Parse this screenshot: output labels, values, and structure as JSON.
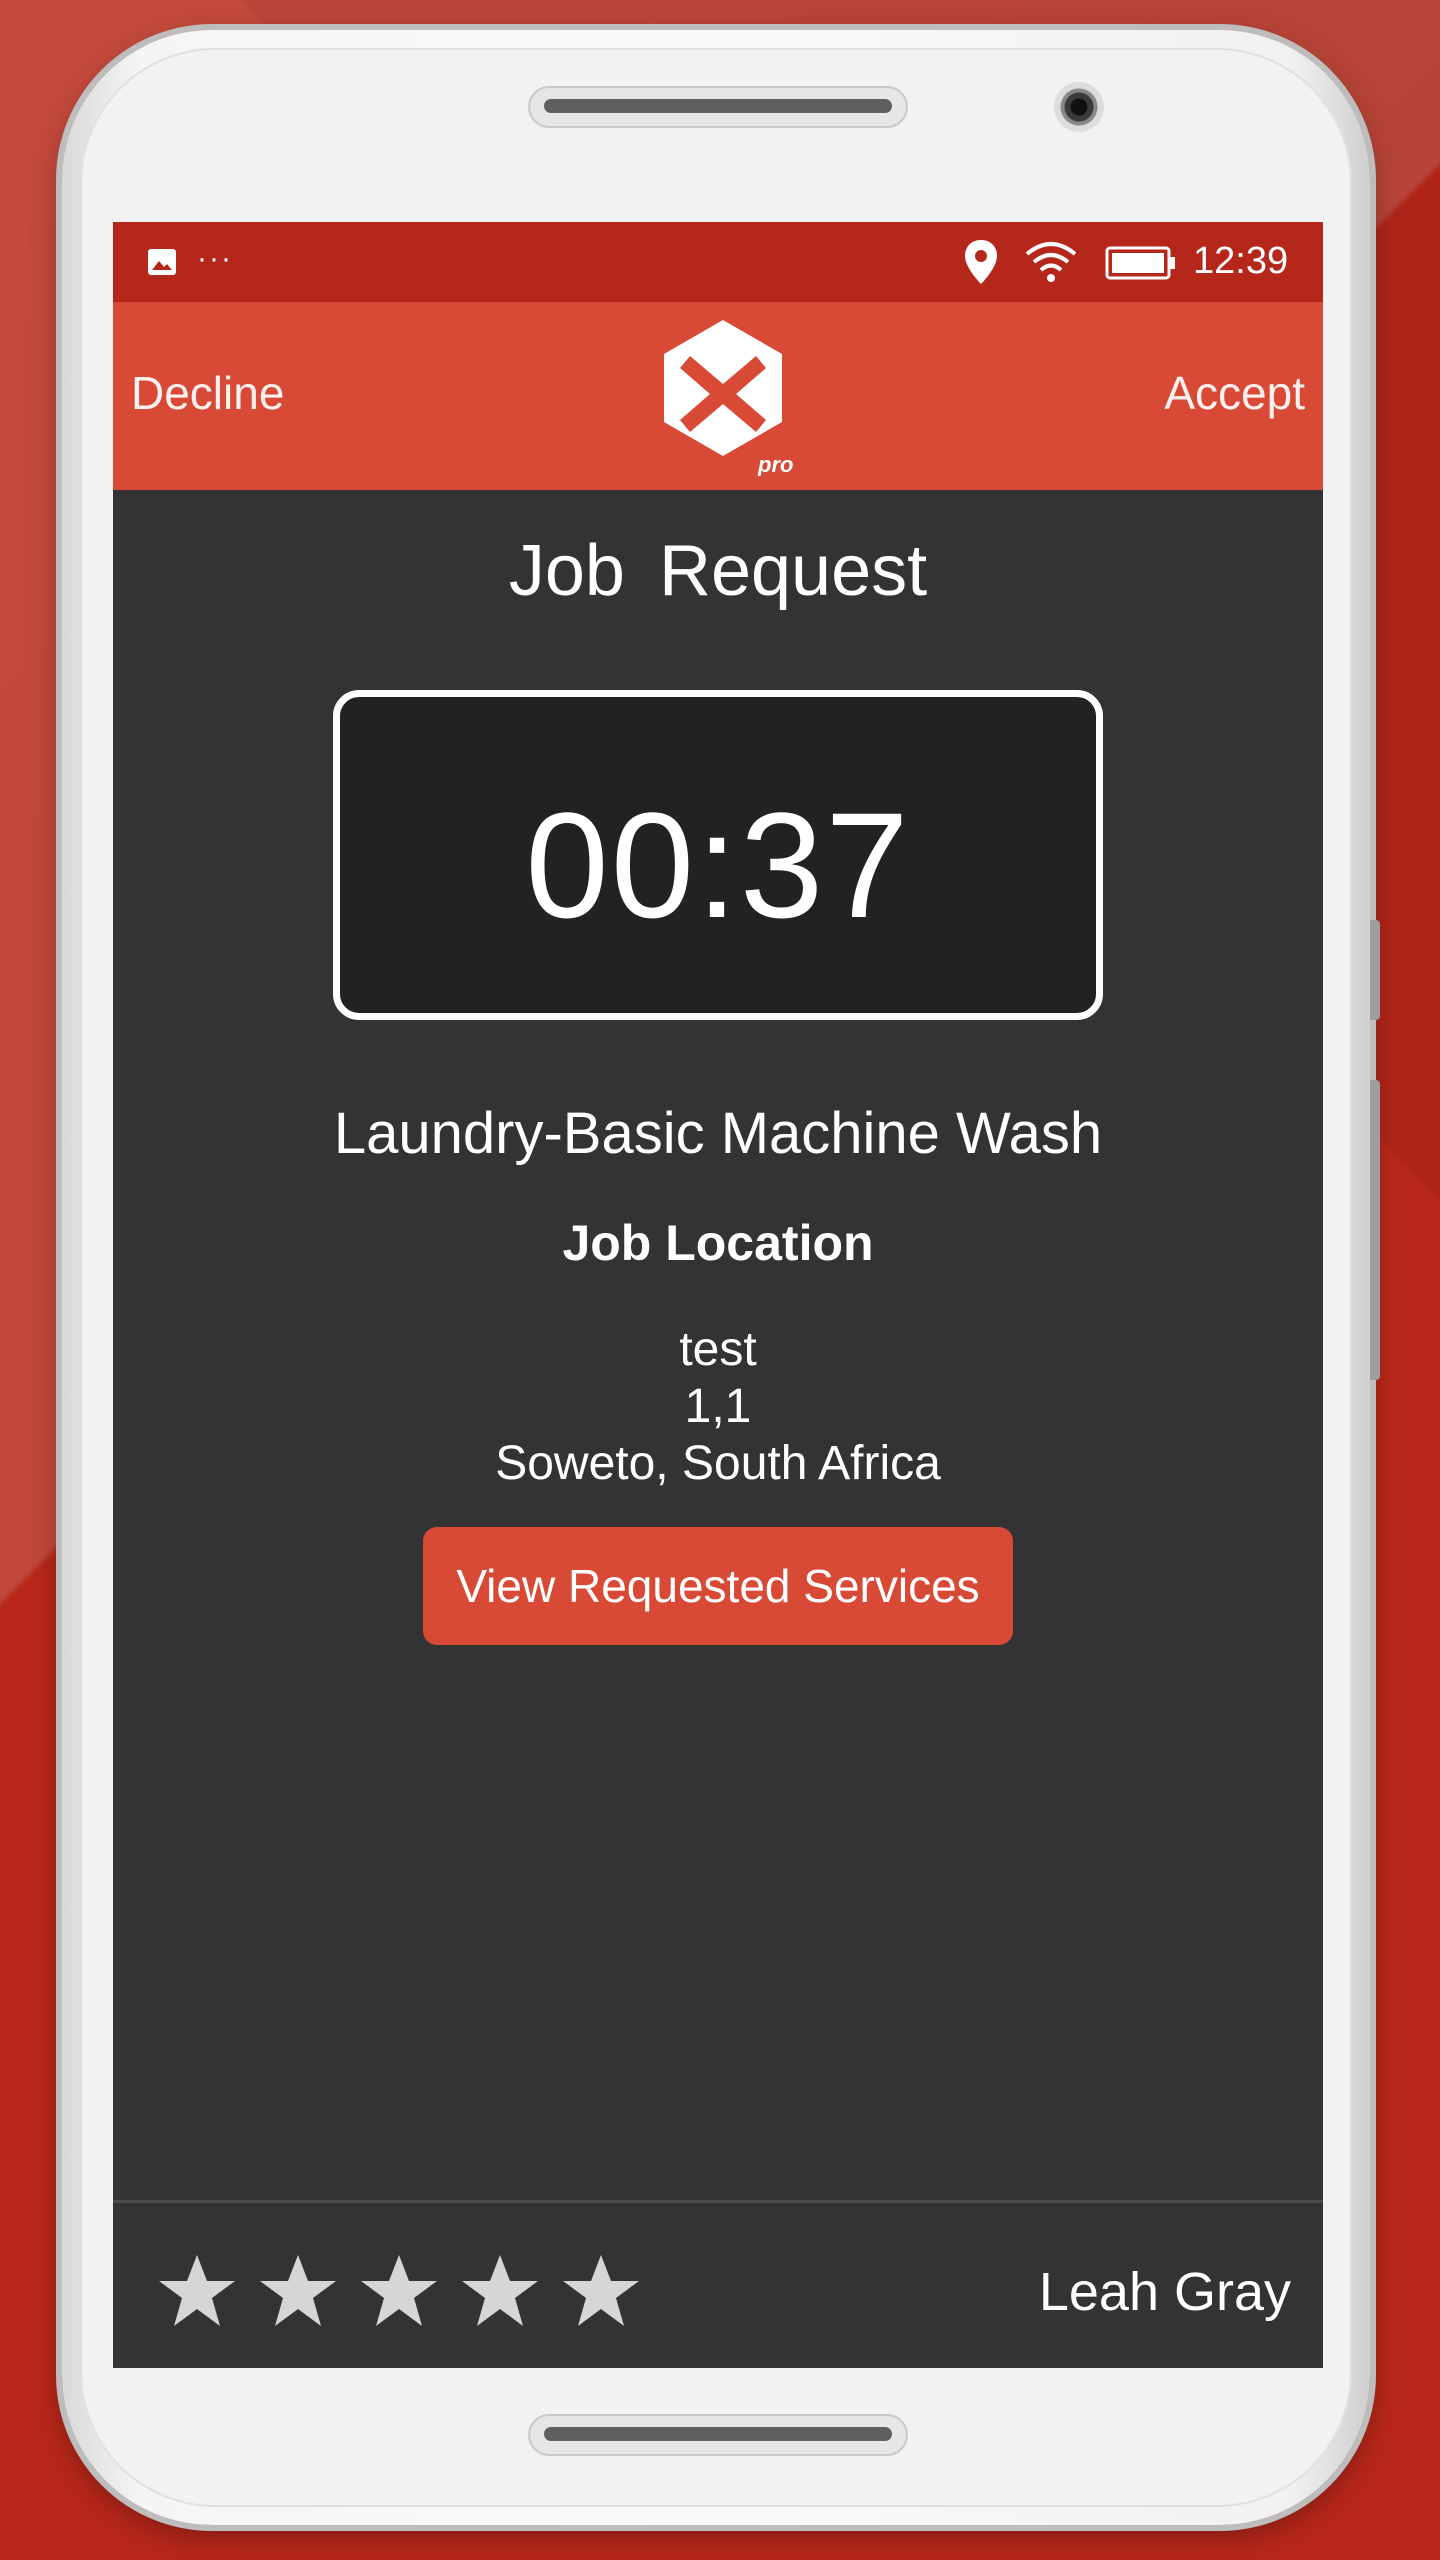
{
  "status_bar": {
    "notification_dots": "···",
    "time": "12:39",
    "icons": [
      "image-icon",
      "location-pin-icon",
      "wifi-icon",
      "battery-icon"
    ]
  },
  "app_bar": {
    "decline_label": "Decline",
    "accept_label": "Accept",
    "logo_badge": "pro"
  },
  "job": {
    "title": "Job  Request",
    "timer": "00:37",
    "service": "Laundry-Basic Machine Wash",
    "location_heading": "Job Location",
    "address_lines": [
      "test",
      "1,1",
      "Soweto, South Africa"
    ],
    "view_services_label": "View Requested Services"
  },
  "footer": {
    "rating": 0,
    "rating_max": 5,
    "user_name": "Leah Gray"
  },
  "colors": {
    "status_bar": "#b5271a",
    "app_bar": "#d84a36",
    "screen_bg": "#333333",
    "timer_bg": "#222222",
    "star": "#d6d6d6"
  }
}
